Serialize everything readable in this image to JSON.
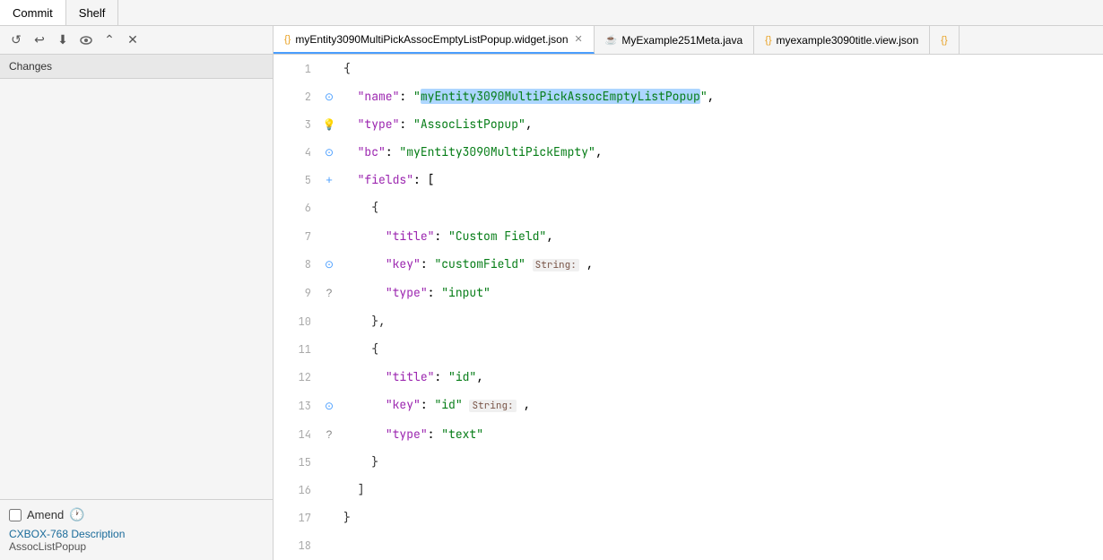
{
  "topTabs": [
    {
      "id": "commit",
      "label": "Commit",
      "active": true
    },
    {
      "id": "shelf",
      "label": "Shelf",
      "active": false
    }
  ],
  "toolbar": {
    "buttons": [
      {
        "id": "refresh",
        "icon": "↺",
        "tooltip": "Refresh",
        "disabled": false
      },
      {
        "id": "undo",
        "icon": "↩",
        "tooltip": "Rollback",
        "disabled": false
      },
      {
        "id": "download",
        "icon": "⬇",
        "tooltip": "Update",
        "disabled": false
      },
      {
        "id": "eye",
        "icon": "👁",
        "tooltip": "View",
        "disabled": false
      },
      {
        "id": "expand",
        "icon": "⌃",
        "tooltip": "Expand",
        "disabled": false
      },
      {
        "id": "close",
        "icon": "✕",
        "tooltip": "Close",
        "disabled": false
      }
    ]
  },
  "changesHeader": "Changes",
  "bottomPanel": {
    "amendLabel": "Amend",
    "commitDescription": "CXBOX-768 Description",
    "commitDescriptionSecondary": "AssocListPopup"
  },
  "editorTabs": [
    {
      "id": "tab1",
      "icon": "{}",
      "iconClass": "tab-icon-json",
      "label": "myEntity3090MultiPickAssocEmptyListPopup.widget.json",
      "active": true,
      "closable": true
    },
    {
      "id": "tab2",
      "icon": "☕",
      "iconClass": "tab-icon-java",
      "label": "MyExample251Meta.java",
      "active": false,
      "closable": false
    },
    {
      "id": "tab3",
      "icon": "{}",
      "iconClass": "tab-icon-json",
      "label": "myexample3090title.view.json",
      "active": false,
      "closable": false
    },
    {
      "id": "tab4",
      "icon": "{}",
      "iconClass": "tab-icon-json",
      "label": "",
      "active": false,
      "closable": false
    }
  ],
  "codeLines": [
    {
      "num": 1,
      "annotation": "",
      "annotationType": "",
      "code": "{"
    },
    {
      "num": 2,
      "annotation": "circle",
      "annotationType": "circle",
      "code": "  \"name\": \"myEntity3090MultiPickAssocEmptyListPopup\","
    },
    {
      "num": 3,
      "annotation": "bulb",
      "annotationType": "bulb",
      "code": "  \"type\": \"AssocListPopup\","
    },
    {
      "num": 4,
      "annotation": "circle",
      "annotationType": "circle",
      "code": "  \"bc\": \"myEntity3090MultiPickEmpty\","
    },
    {
      "num": 5,
      "annotation": "plus",
      "annotationType": "plus",
      "code": "  \"fields\": ["
    },
    {
      "num": 6,
      "annotation": "",
      "annotationType": "",
      "code": "    {"
    },
    {
      "num": 7,
      "annotation": "",
      "annotationType": "",
      "code": "      \"title\": \"Custom Field\","
    },
    {
      "num": 8,
      "annotation": "circle",
      "annotationType": "circle",
      "code": "      \"key\": \"customField\" String: ,"
    },
    {
      "num": 9,
      "annotation": "question",
      "annotationType": "question",
      "code": "      \"type\": \"input\""
    },
    {
      "num": 10,
      "annotation": "",
      "annotationType": "",
      "code": "    },"
    },
    {
      "num": 11,
      "annotation": "",
      "annotationType": "",
      "code": "    {"
    },
    {
      "num": 12,
      "annotation": "",
      "annotationType": "",
      "code": "      \"title\": \"id\","
    },
    {
      "num": 13,
      "annotation": "circle",
      "annotationType": "circle",
      "code": "      \"key\": \"id\" String: ,"
    },
    {
      "num": 14,
      "annotation": "question",
      "annotationType": "question",
      "code": "      \"type\": \"text\""
    },
    {
      "num": 15,
      "annotation": "",
      "annotationType": "",
      "code": "    }"
    },
    {
      "num": 16,
      "annotation": "",
      "annotationType": "",
      "code": "  ]"
    },
    {
      "num": 17,
      "annotation": "",
      "annotationType": "",
      "code": "}"
    },
    {
      "num": 18,
      "annotation": "",
      "annotationType": "",
      "code": ""
    }
  ]
}
